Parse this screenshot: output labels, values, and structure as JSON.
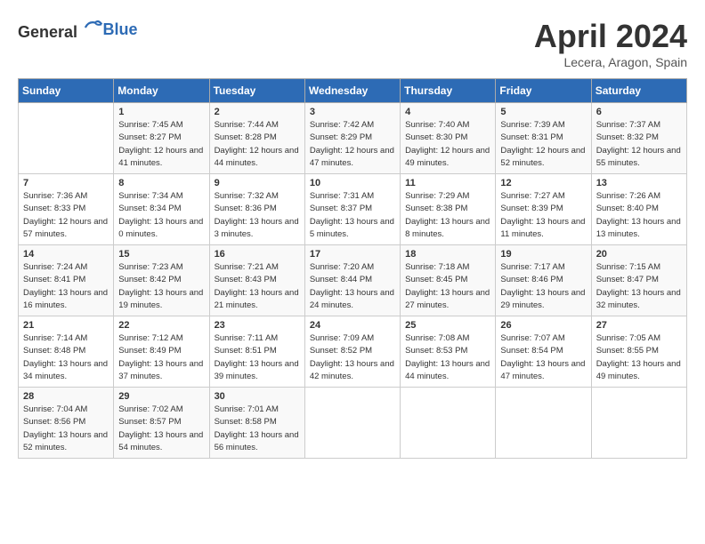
{
  "header": {
    "logo_general": "General",
    "logo_blue": "Blue",
    "month_title": "April 2024",
    "location": "Lecera, Aragon, Spain"
  },
  "days_of_week": [
    "Sunday",
    "Monday",
    "Tuesday",
    "Wednesday",
    "Thursday",
    "Friday",
    "Saturday"
  ],
  "weeks": [
    [
      {
        "day": "",
        "sunrise": "",
        "sunset": "",
        "daylight": ""
      },
      {
        "day": "1",
        "sunrise": "Sunrise: 7:45 AM",
        "sunset": "Sunset: 8:27 PM",
        "daylight": "Daylight: 12 hours and 41 minutes."
      },
      {
        "day": "2",
        "sunrise": "Sunrise: 7:44 AM",
        "sunset": "Sunset: 8:28 PM",
        "daylight": "Daylight: 12 hours and 44 minutes."
      },
      {
        "day": "3",
        "sunrise": "Sunrise: 7:42 AM",
        "sunset": "Sunset: 8:29 PM",
        "daylight": "Daylight: 12 hours and 47 minutes."
      },
      {
        "day": "4",
        "sunrise": "Sunrise: 7:40 AM",
        "sunset": "Sunset: 8:30 PM",
        "daylight": "Daylight: 12 hours and 49 minutes."
      },
      {
        "day": "5",
        "sunrise": "Sunrise: 7:39 AM",
        "sunset": "Sunset: 8:31 PM",
        "daylight": "Daylight: 12 hours and 52 minutes."
      },
      {
        "day": "6",
        "sunrise": "Sunrise: 7:37 AM",
        "sunset": "Sunset: 8:32 PM",
        "daylight": "Daylight: 12 hours and 55 minutes."
      }
    ],
    [
      {
        "day": "7",
        "sunrise": "Sunrise: 7:36 AM",
        "sunset": "Sunset: 8:33 PM",
        "daylight": "Daylight: 12 hours and 57 minutes."
      },
      {
        "day": "8",
        "sunrise": "Sunrise: 7:34 AM",
        "sunset": "Sunset: 8:34 PM",
        "daylight": "Daylight: 13 hours and 0 minutes."
      },
      {
        "day": "9",
        "sunrise": "Sunrise: 7:32 AM",
        "sunset": "Sunset: 8:36 PM",
        "daylight": "Daylight: 13 hours and 3 minutes."
      },
      {
        "day": "10",
        "sunrise": "Sunrise: 7:31 AM",
        "sunset": "Sunset: 8:37 PM",
        "daylight": "Daylight: 13 hours and 5 minutes."
      },
      {
        "day": "11",
        "sunrise": "Sunrise: 7:29 AM",
        "sunset": "Sunset: 8:38 PM",
        "daylight": "Daylight: 13 hours and 8 minutes."
      },
      {
        "day": "12",
        "sunrise": "Sunrise: 7:27 AM",
        "sunset": "Sunset: 8:39 PM",
        "daylight": "Daylight: 13 hours and 11 minutes."
      },
      {
        "day": "13",
        "sunrise": "Sunrise: 7:26 AM",
        "sunset": "Sunset: 8:40 PM",
        "daylight": "Daylight: 13 hours and 13 minutes."
      }
    ],
    [
      {
        "day": "14",
        "sunrise": "Sunrise: 7:24 AM",
        "sunset": "Sunset: 8:41 PM",
        "daylight": "Daylight: 13 hours and 16 minutes."
      },
      {
        "day": "15",
        "sunrise": "Sunrise: 7:23 AM",
        "sunset": "Sunset: 8:42 PM",
        "daylight": "Daylight: 13 hours and 19 minutes."
      },
      {
        "day": "16",
        "sunrise": "Sunrise: 7:21 AM",
        "sunset": "Sunset: 8:43 PM",
        "daylight": "Daylight: 13 hours and 21 minutes."
      },
      {
        "day": "17",
        "sunrise": "Sunrise: 7:20 AM",
        "sunset": "Sunset: 8:44 PM",
        "daylight": "Daylight: 13 hours and 24 minutes."
      },
      {
        "day": "18",
        "sunrise": "Sunrise: 7:18 AM",
        "sunset": "Sunset: 8:45 PM",
        "daylight": "Daylight: 13 hours and 27 minutes."
      },
      {
        "day": "19",
        "sunrise": "Sunrise: 7:17 AM",
        "sunset": "Sunset: 8:46 PM",
        "daylight": "Daylight: 13 hours and 29 minutes."
      },
      {
        "day": "20",
        "sunrise": "Sunrise: 7:15 AM",
        "sunset": "Sunset: 8:47 PM",
        "daylight": "Daylight: 13 hours and 32 minutes."
      }
    ],
    [
      {
        "day": "21",
        "sunrise": "Sunrise: 7:14 AM",
        "sunset": "Sunset: 8:48 PM",
        "daylight": "Daylight: 13 hours and 34 minutes."
      },
      {
        "day": "22",
        "sunrise": "Sunrise: 7:12 AM",
        "sunset": "Sunset: 8:49 PM",
        "daylight": "Daylight: 13 hours and 37 minutes."
      },
      {
        "day": "23",
        "sunrise": "Sunrise: 7:11 AM",
        "sunset": "Sunset: 8:51 PM",
        "daylight": "Daylight: 13 hours and 39 minutes."
      },
      {
        "day": "24",
        "sunrise": "Sunrise: 7:09 AM",
        "sunset": "Sunset: 8:52 PM",
        "daylight": "Daylight: 13 hours and 42 minutes."
      },
      {
        "day": "25",
        "sunrise": "Sunrise: 7:08 AM",
        "sunset": "Sunset: 8:53 PM",
        "daylight": "Daylight: 13 hours and 44 minutes."
      },
      {
        "day": "26",
        "sunrise": "Sunrise: 7:07 AM",
        "sunset": "Sunset: 8:54 PM",
        "daylight": "Daylight: 13 hours and 47 minutes."
      },
      {
        "day": "27",
        "sunrise": "Sunrise: 7:05 AM",
        "sunset": "Sunset: 8:55 PM",
        "daylight": "Daylight: 13 hours and 49 minutes."
      }
    ],
    [
      {
        "day": "28",
        "sunrise": "Sunrise: 7:04 AM",
        "sunset": "Sunset: 8:56 PM",
        "daylight": "Daylight: 13 hours and 52 minutes."
      },
      {
        "day": "29",
        "sunrise": "Sunrise: 7:02 AM",
        "sunset": "Sunset: 8:57 PM",
        "daylight": "Daylight: 13 hours and 54 minutes."
      },
      {
        "day": "30",
        "sunrise": "Sunrise: 7:01 AM",
        "sunset": "Sunset: 8:58 PM",
        "daylight": "Daylight: 13 hours and 56 minutes."
      },
      {
        "day": "",
        "sunrise": "",
        "sunset": "",
        "daylight": ""
      },
      {
        "day": "",
        "sunrise": "",
        "sunset": "",
        "daylight": ""
      },
      {
        "day": "",
        "sunrise": "",
        "sunset": "",
        "daylight": ""
      },
      {
        "day": "",
        "sunrise": "",
        "sunset": "",
        "daylight": ""
      }
    ]
  ]
}
